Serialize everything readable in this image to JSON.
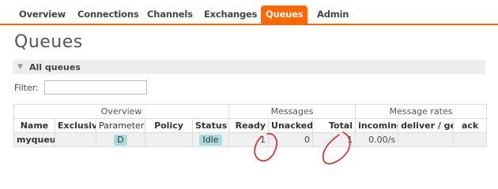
{
  "nav": {
    "tabs": [
      "Overview",
      "Connections",
      "Channels",
      "Exchanges",
      "Queues",
      "Admin"
    ],
    "active": "Queues",
    "accent_color": "#ff6600"
  },
  "page": {
    "title": "Queues"
  },
  "section": {
    "label": "All queues",
    "icon": "triangle-down-icon"
  },
  "filter": {
    "label": "Filter:",
    "value": ""
  },
  "table": {
    "groups": {
      "overview": "Overview",
      "messages": "Messages",
      "rates": "Message rates"
    },
    "columns": [
      "Name",
      "Exclusive",
      "Parameters",
      "Policy",
      "Status",
      "Ready",
      "Unacked",
      "Total",
      "incoming",
      "deliver / get",
      "ack"
    ],
    "rows": [
      {
        "name": "myqueue",
        "exclusive": "",
        "parameters": "D",
        "policy": "",
        "status": "Idle",
        "ready": "1",
        "unacked": "0",
        "total": "1",
        "incoming": "0.00/s",
        "deliver_get": "",
        "ack": ""
      }
    ]
  },
  "annotations": {
    "color": "#e02020"
  }
}
